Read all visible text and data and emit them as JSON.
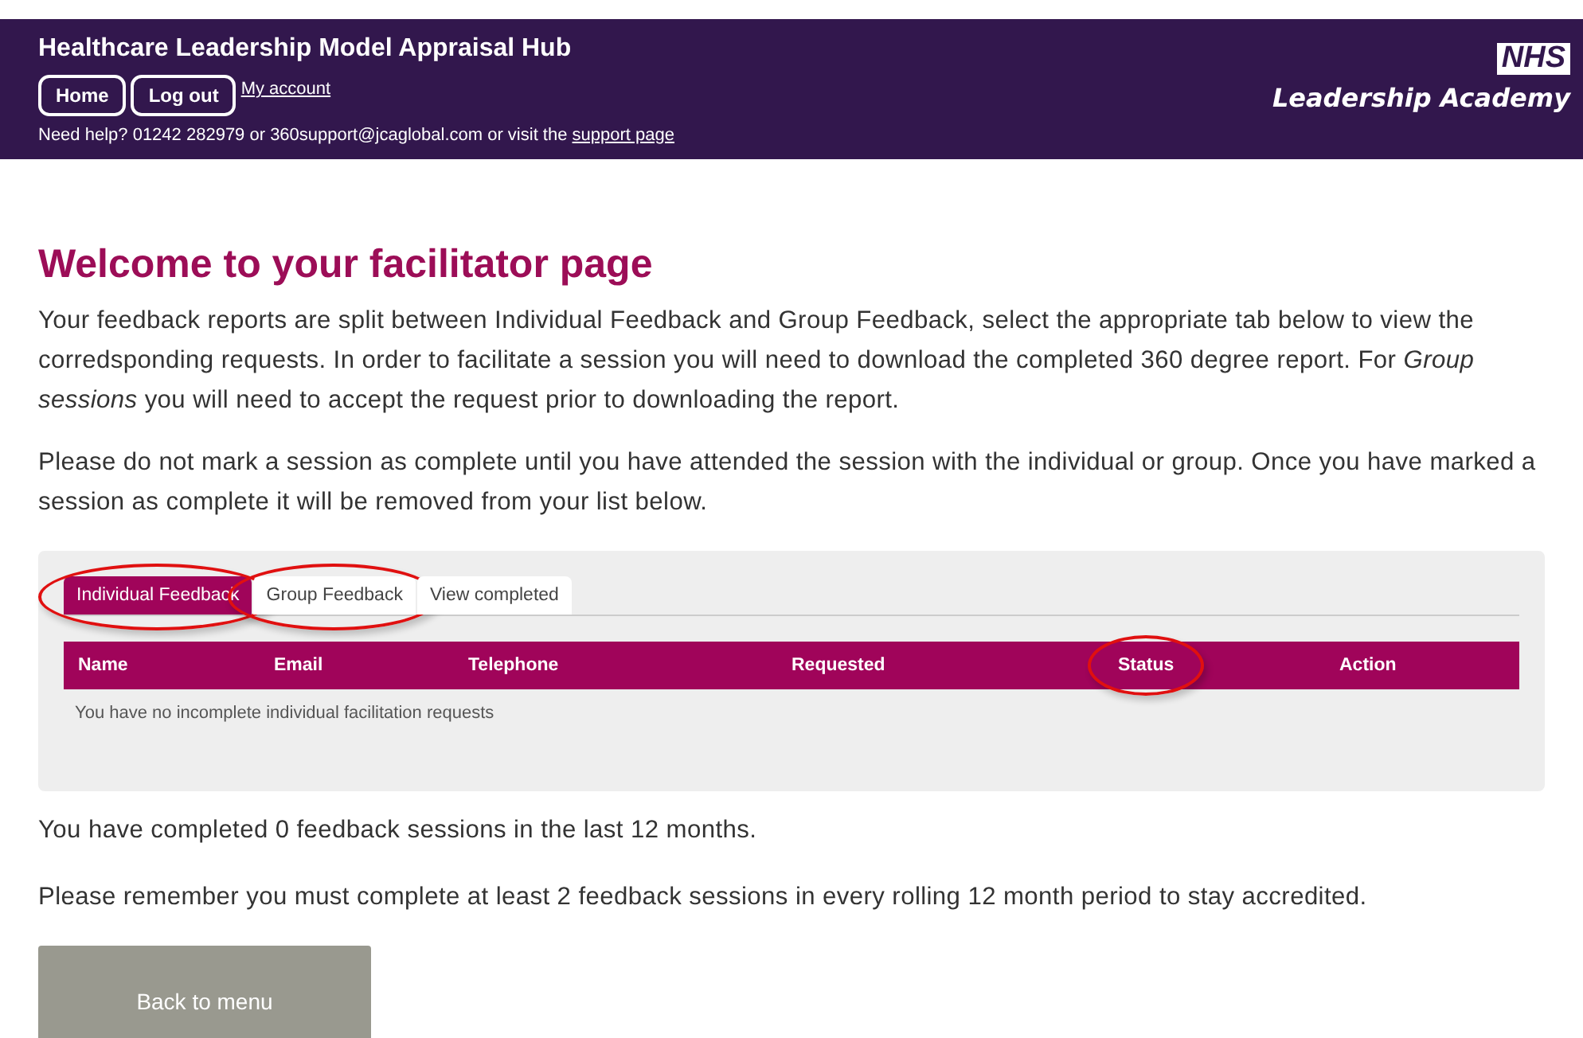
{
  "header": {
    "title": "Healthcare Leadership Model Appraisal Hub",
    "buttons": [
      "Home",
      "Log out"
    ],
    "account_link": "My account",
    "help_text": "Need help? 01242 282979 or 360support@jcaglobal.com or visit the",
    "help_link": "support page",
    "logo_badge": "NHS",
    "logo_text": "Leadership Academy"
  },
  "heading": "Welcome to your facilitator page",
  "intro": "Your feedback reports are split between Individual Feedback and Group Feedback, select the appropriate tab below to view the corredsponding requests. In order to facilitate a session you will need to download the completed 360 degree report. For *Group sessions* you will need to accept the request prior to downloading the report.",
  "notice": "Please do not mark a session as complete until you have attended the session with the individual or group. Once you have marked a session as complete it will be removed from your list below.",
  "tabs": [
    {
      "label": "Individual Feedback",
      "selected": true,
      "circled": true
    },
    {
      "label": "Group Feedback",
      "selected": false,
      "circled": true
    },
    {
      "label": "View completed",
      "selected": false,
      "circled": false
    }
  ],
  "table": {
    "columns": [
      {
        "label": "Name",
        "circled": false
      },
      {
        "label": "Email",
        "circled": false
      },
      {
        "label": "Telephone",
        "circled": false
      },
      {
        "label": "Requested",
        "circled": false
      },
      {
        "label": "Status",
        "circled": true
      },
      {
        "label": "Action",
        "circled": false
      }
    ],
    "empty_message": "You have no incomplete individual facilitation requests"
  },
  "completed_text": "You have completed 0 feedback sessions in the last 12 months.",
  "reminder_text": "Please remember you must complete at least 2 feedback sessions in every rolling 12 month period to stay accredited.",
  "back_button": "Back to menu"
}
